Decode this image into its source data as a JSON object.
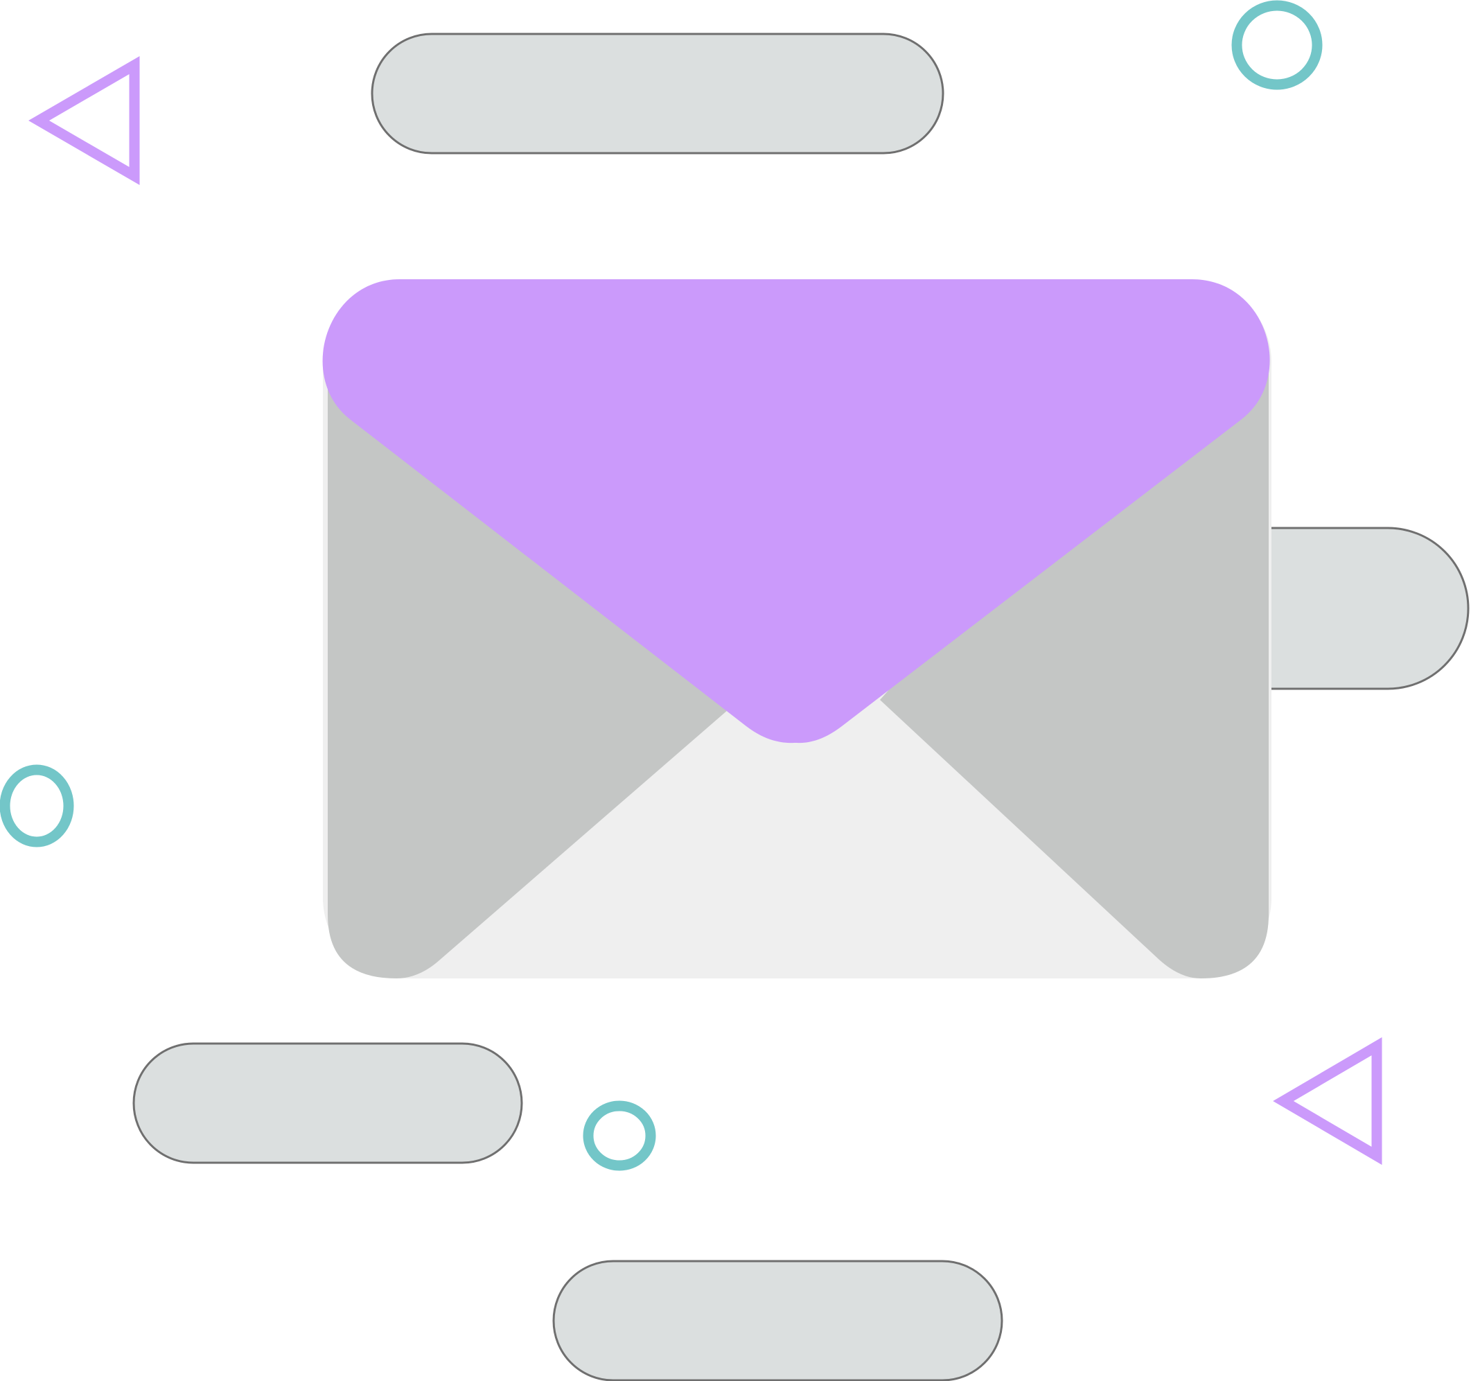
{
  "illustration": {
    "subject": "envelope-icon",
    "colors": {
      "background": "#ffffff",
      "envelope_flap": "#cb9afb",
      "envelope_side": "#c4c6c5",
      "envelope_front": "#efefef",
      "pill_fill": "#dbdfdf",
      "pill_stroke": "#6f6f6f",
      "triangle_stroke": "#cb9afb",
      "circle_stroke": "#73c6c8"
    },
    "decorations": [
      "pill-shape",
      "triangle-outline-icon",
      "circle-outline-icon"
    ]
  }
}
